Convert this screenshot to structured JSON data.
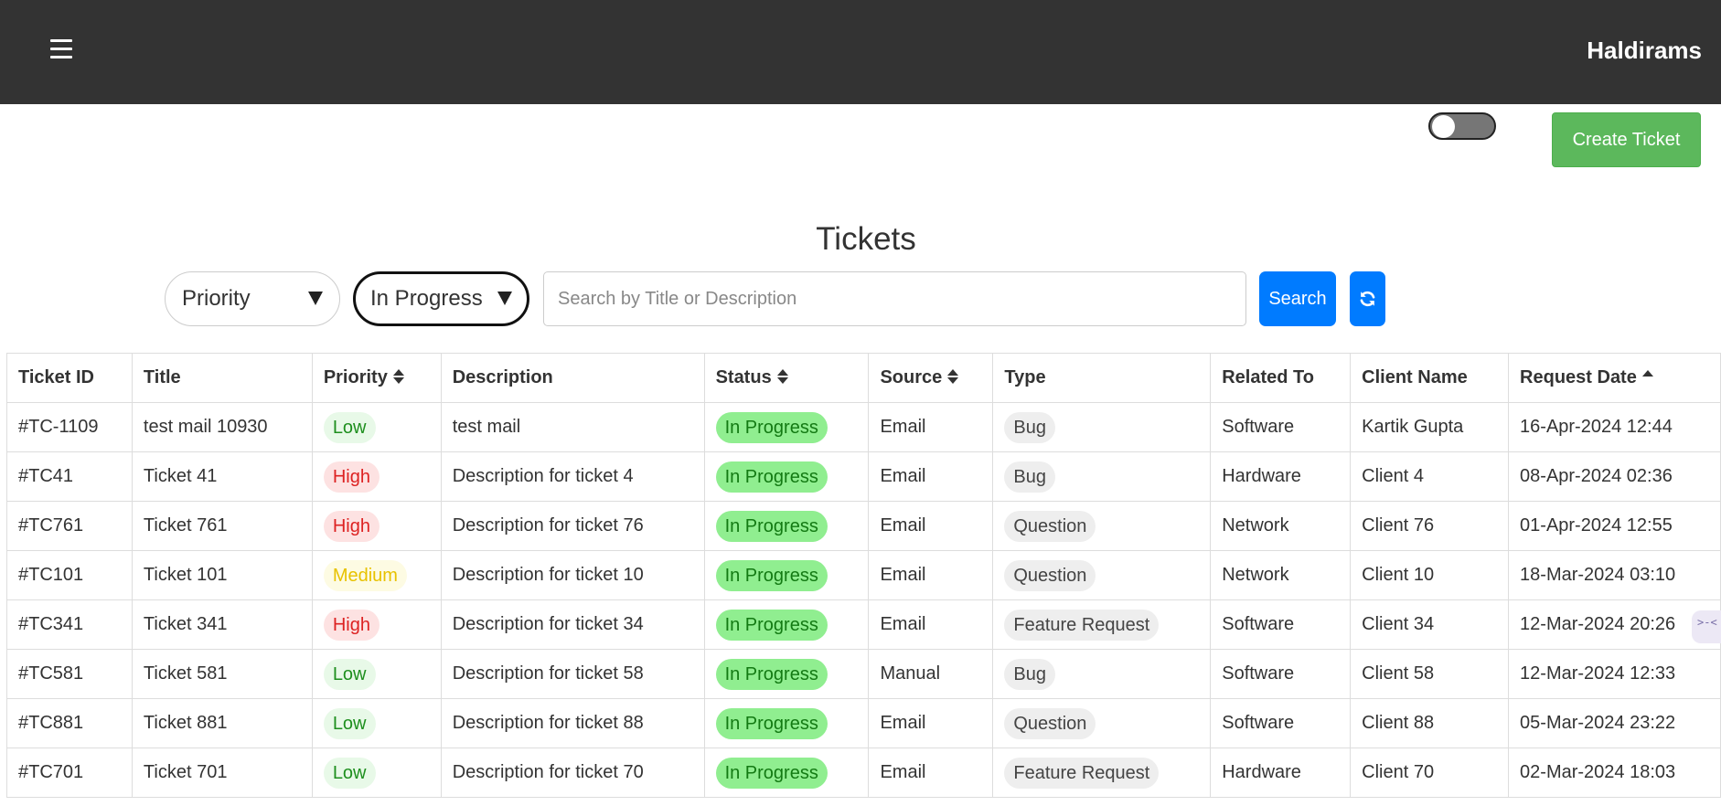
{
  "header": {
    "brand": "Haldirams",
    "menu_icon": "hamburger-menu-icon"
  },
  "toolbar": {
    "toggle_state": "off",
    "create_ticket_label": "Create Ticket"
  },
  "page": {
    "title": "Tickets"
  },
  "filters": {
    "priority_value": "Priority",
    "status_value": "In Progress",
    "search_placeholder": "Search by Title or Description",
    "search_label": "Search",
    "refresh_icon": "refresh-icon"
  },
  "table": {
    "columns": [
      {
        "label": "Ticket ID",
        "sort": "none"
      },
      {
        "label": "Title",
        "sort": "none"
      },
      {
        "label": "Priority",
        "sort": "sortable"
      },
      {
        "label": "Description",
        "sort": "none"
      },
      {
        "label": "Status",
        "sort": "sortable"
      },
      {
        "label": "Source",
        "sort": "sortable"
      },
      {
        "label": "Type",
        "sort": "none"
      },
      {
        "label": "Related To",
        "sort": "none"
      },
      {
        "label": "Client Name",
        "sort": "none"
      },
      {
        "label": "Request Date",
        "sort": "ascending"
      }
    ],
    "rows": [
      {
        "id": "#TC-1109",
        "title": "test mail 10930",
        "priority": "Low",
        "description": "test mail",
        "status": "In Progress",
        "source": "Email",
        "type": "Bug",
        "related_to": "Software",
        "client": "Kartik Gupta",
        "date": "16-Apr-2024 12:44"
      },
      {
        "id": "#TC41",
        "title": "Ticket 41",
        "priority": "High",
        "description": "Description for ticket 4",
        "status": "In Progress",
        "source": "Email",
        "type": "Bug",
        "related_to": "Hardware",
        "client": "Client 4",
        "date": "08-Apr-2024 02:36"
      },
      {
        "id": "#TC761",
        "title": "Ticket 761",
        "priority": "High",
        "description": "Description for ticket 76",
        "status": "In Progress",
        "source": "Email",
        "type": "Question",
        "related_to": "Network",
        "client": "Client 76",
        "date": "01-Apr-2024 12:55"
      },
      {
        "id": "#TC101",
        "title": "Ticket 101",
        "priority": "Medium",
        "description": "Description for ticket 10",
        "status": "In Progress",
        "source": "Email",
        "type": "Question",
        "related_to": "Network",
        "client": "Client 10",
        "date": "18-Mar-2024 03:10"
      },
      {
        "id": "#TC341",
        "title": "Ticket 341",
        "priority": "High",
        "description": "Description for ticket 34",
        "status": "In Progress",
        "source": "Email",
        "type": "Feature Request",
        "related_to": "Software",
        "client": "Client 34",
        "date": "12-Mar-2024 20:26"
      },
      {
        "id": "#TC581",
        "title": "Ticket 581",
        "priority": "Low",
        "description": "Description for ticket 58",
        "status": "In Progress",
        "source": "Manual",
        "type": "Bug",
        "related_to": "Software",
        "client": "Client 58",
        "date": "12-Mar-2024 12:33"
      },
      {
        "id": "#TC881",
        "title": "Ticket 881",
        "priority": "Low",
        "description": "Description for ticket 88",
        "status": "In Progress",
        "source": "Email",
        "type": "Question",
        "related_to": "Software",
        "client": "Client 88",
        "date": "05-Mar-2024 23:22"
      },
      {
        "id": "#TC701",
        "title": "Ticket 701",
        "priority": "Low",
        "description": "Description for ticket 70",
        "status": "In Progress",
        "source": "Email",
        "type": "Feature Request",
        "related_to": "Hardware",
        "client": "Client 70",
        "date": "02-Mar-2024 18:03"
      }
    ]
  },
  "colors": {
    "topbar": "#333333",
    "create_button": "#5cb85c",
    "primary_button": "#007bff",
    "status_badge": "#90ee90",
    "priority_low": "#1e8f1e",
    "priority_high": "#dd2222",
    "priority_medium": "#e8c200"
  }
}
